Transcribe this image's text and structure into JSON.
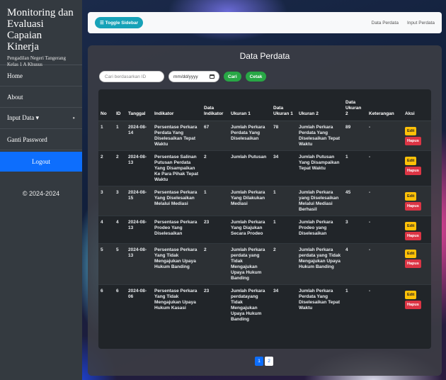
{
  "sidebar": {
    "title": "Monitoring dan Evaluasi Capaian Kinerja",
    "subtitle": "Pengadilan Negeri Tangerang Kelas 1 A Khusus",
    "items": [
      {
        "label": "Home"
      },
      {
        "label": "About"
      },
      {
        "label": "Input Data ▾"
      },
      {
        "label": "Ganti Password"
      }
    ],
    "logout": "Logout",
    "copyright": "© 2024-2024"
  },
  "topbar": {
    "toggle_label": "☰ Toggle Sidebar",
    "links": [
      "Data Perdata",
      "Input Perdata"
    ]
  },
  "main": {
    "title": "Data Perdata",
    "search_placeholder": "Cari berdasarkan ID",
    "date_placeholder": "mm/dd/yyyy",
    "search_button": "Cari",
    "print_button": "Cetak"
  },
  "table": {
    "headers": [
      "No",
      "ID",
      "Tanggal",
      "Indikator",
      "Data Indikator",
      "Ukuran 1",
      "Data Ukuran 1",
      "Ukuran 2",
      "Data Ukuran 2",
      "Keterangan",
      "Aksi"
    ],
    "edit_label": "Edit",
    "delete_label": "Hapus",
    "rows": [
      {
        "no": "1",
        "id": "1",
        "tanggal": "2024-08-14",
        "indikator": "Persentase Perkara Perdata Yang Diselesaikan Tepat Waktu",
        "data_indikator": "67",
        "ukuran1": "Jumlah Perkara Perdata Yang Diselesaikan",
        "data_ukuran1": "78",
        "ukuran2": "Jumlah Perkara Perdata Yang Diselesaikan Tepat Waktu",
        "data_ukuran2": "89",
        "keterangan": "-"
      },
      {
        "no": "2",
        "id": "2",
        "tanggal": "2024-08-13",
        "indikator": "Persentase Salinan Putusan Perdata Yang Disampaikan Ke Para Pihak Tepat Waktu",
        "data_indikator": "2",
        "ukuran1": "Jumlah Putusan",
        "data_ukuran1": "34",
        "ukuran2": "Jumlah Putusan Yang Disampaikan Tepat Waktu",
        "data_ukuran2": "1",
        "keterangan": "-"
      },
      {
        "no": "3",
        "id": "3",
        "tanggal": "2024-08-15",
        "indikator": "Persentase Perkara Yang Diselesaikan Melalui Mediasi",
        "data_indikator": "1",
        "ukuran1": "Jumlah Perkara Yang Dilakukan Mediasi",
        "data_ukuran1": "1",
        "ukuran2": "Jumlah Perkara yang Diselesaikan Melalui Mediasi Berhasil",
        "data_ukuran2": "45",
        "keterangan": "-"
      },
      {
        "no": "4",
        "id": "4",
        "tanggal": "2024-08-13",
        "indikator": "Persentase Perkara Prodeo Yang Diselesaikan",
        "data_indikator": "23",
        "ukuran1": "Jumlah Perkara Yang Diajukan Secara Prodeo",
        "data_ukuran1": "1",
        "ukuran2": "Jumlah Perkara Prodeo yang Diselesaikan",
        "data_ukuran2": "3",
        "keterangan": "-"
      },
      {
        "no": "5",
        "id": "5",
        "tanggal": "2024-08-13",
        "indikator": "Persentase Perkara Yang Tidak Mengajukan Upaya Hukum Banding",
        "data_indikator": "2",
        "ukuran1": "Jumlah Perkara perdata yang Tidak Mengajukan Upaya Hukum Banding",
        "data_ukuran1": "2",
        "ukuran2": "Jumlah Perkara perdata yang Tidak Mengajukan Upaya Hukum Banding",
        "data_ukuran2": "4",
        "keterangan": "-"
      },
      {
        "no": "6",
        "id": "6",
        "tanggal": "2024-08-06",
        "indikator": "Persentase Perkara Yang Tidak Mengajukan Upaya Hukum Kasasi",
        "data_indikator": "23",
        "ukuran1": "Jumlah Perkara perdatayang Tidak Mengajukan Upaya Hukum Banding",
        "data_ukuran1": "34",
        "ukuran2": "Jumlah Perkara Perdata Yang Diselesaikan Tepat Waktu",
        "data_ukuran2": "1",
        "keterangan": "-"
      }
    ]
  },
  "pagination": {
    "pages": [
      "1",
      "2"
    ],
    "active": "1"
  }
}
